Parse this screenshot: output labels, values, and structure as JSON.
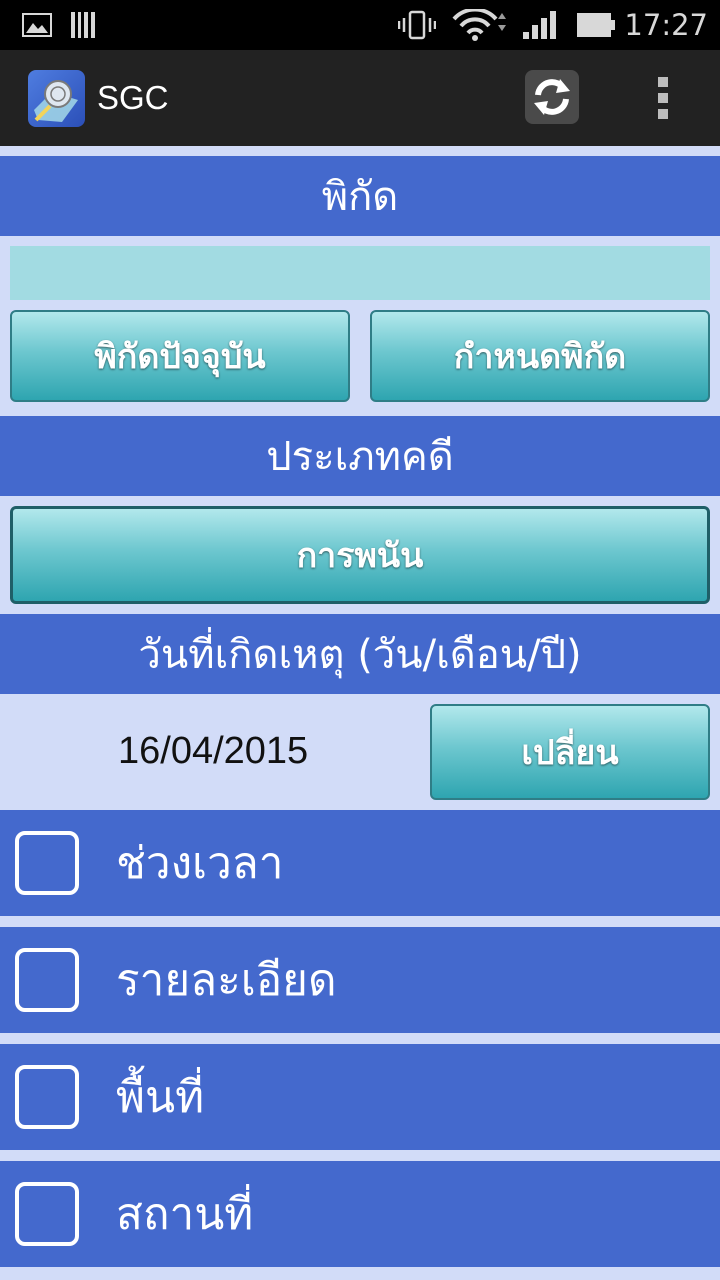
{
  "status_bar": {
    "time": "17:27"
  },
  "app_bar": {
    "title": "SGC"
  },
  "sections": {
    "location_header": "พิกัด",
    "location_value": "",
    "current_location_button": "พิกัดปัจจุบัน",
    "set_location_button": "กำหนดพิกัด",
    "case_type_header": "ประเภทคดี",
    "case_type_value": "การพนัน",
    "incident_date_header": "วันที่เกิดเหตุ (วัน/เดือน/ปี)",
    "incident_date_value": "16/04/2015",
    "change_date_button": "เปลี่ยน"
  },
  "checkboxes": [
    {
      "label": "ช่วงเวลา",
      "checked": false
    },
    {
      "label": "รายละเอียด",
      "checked": false
    },
    {
      "label": "พื้นที่",
      "checked": false
    },
    {
      "label": "สถานที่",
      "checked": false
    }
  ],
  "colors": {
    "section_band": "#4469cd",
    "background": "#d2dcf8",
    "input_fill": "#a2dbe2",
    "button_teal": "#2ea5b0"
  }
}
